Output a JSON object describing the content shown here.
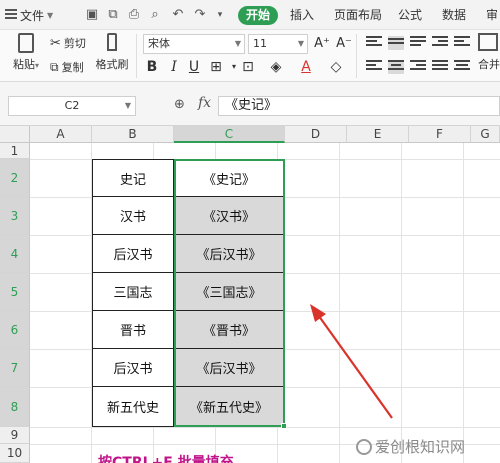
{
  "topbar": {
    "file_menu": "文件",
    "tabs": [
      {
        "label": "开始",
        "active": true
      },
      {
        "label": "插入"
      },
      {
        "label": "页面布局"
      },
      {
        "label": "公式"
      },
      {
        "label": "数据"
      },
      {
        "label": "审"
      }
    ]
  },
  "ribbon": {
    "paste": "粘贴",
    "cut": "剪切",
    "copy": "复制",
    "format_painter": "格式刷",
    "font_name": "宋体",
    "font_size": "11",
    "merge": "合并"
  },
  "formula_bar": {
    "cell_ref": "C2",
    "fx": "fx",
    "value": "《史记》"
  },
  "grid": {
    "columns": [
      "A",
      "B",
      "C",
      "D",
      "E",
      "F",
      "G"
    ],
    "rows": [
      "1",
      "2",
      "3",
      "4",
      "5",
      "6",
      "7",
      "8",
      "9",
      "10"
    ],
    "col_b": [
      "史记",
      "汉书",
      "后汉书",
      "三国志",
      "晋书",
      "后汉书",
      "新五代史"
    ],
    "col_c": [
      "《史记》",
      "《汉书》",
      "《后汉书》",
      "《三国志》",
      "《晋书》",
      "《后汉书》",
      "《新五代史》"
    ]
  },
  "caption": "按CTRL+E 批量填充",
  "watermark": "爱创根知识网",
  "colors": {
    "accent": "#2f9e55",
    "caption": "#c0148a",
    "arrow": "#d9342b"
  }
}
